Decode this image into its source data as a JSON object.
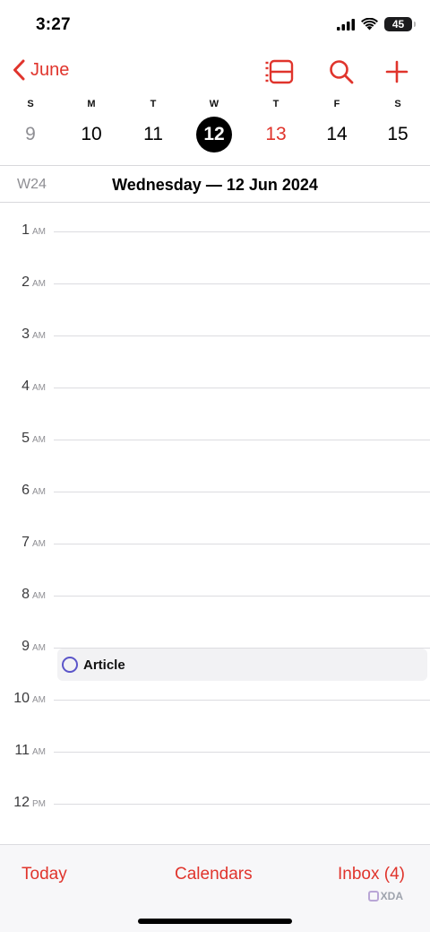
{
  "status_bar": {
    "time": "3:27",
    "battery": "45"
  },
  "nav": {
    "back_label": "June"
  },
  "week": {
    "days": [
      {
        "letter": "S",
        "number": "9",
        "style": "muted"
      },
      {
        "letter": "M",
        "number": "10",
        "style": "normal"
      },
      {
        "letter": "T",
        "number": "11",
        "style": "normal"
      },
      {
        "letter": "W",
        "number": "12",
        "style": "selected"
      },
      {
        "letter": "T",
        "number": "13",
        "style": "today"
      },
      {
        "letter": "F",
        "number": "14",
        "style": "normal"
      },
      {
        "letter": "S",
        "number": "15",
        "style": "normal"
      }
    ]
  },
  "date_header": {
    "week_label": "W24",
    "title": "Wednesday — 12 Jun 2024"
  },
  "timeline": {
    "hours": [
      {
        "num": "1",
        "ampm": "AM"
      },
      {
        "num": "2",
        "ampm": "AM"
      },
      {
        "num": "3",
        "ampm": "AM"
      },
      {
        "num": "4",
        "ampm": "AM"
      },
      {
        "num": "5",
        "ampm": "AM"
      },
      {
        "num": "6",
        "ampm": "AM"
      },
      {
        "num": "7",
        "ampm": "AM"
      },
      {
        "num": "8",
        "ampm": "AM"
      },
      {
        "num": "9",
        "ampm": "AM"
      },
      {
        "num": "10",
        "ampm": "AM"
      },
      {
        "num": "11",
        "ampm": "AM"
      },
      {
        "num": "12",
        "ampm": "PM"
      }
    ]
  },
  "event": {
    "title": "Article",
    "circle_color": "#5b55c9"
  },
  "tabs": {
    "today": "Today",
    "calendars": "Calendars",
    "inbox": "Inbox (4)"
  },
  "watermark": "XDA",
  "colors": {
    "accent": "#e0342c",
    "selected_bg": "#000000"
  }
}
